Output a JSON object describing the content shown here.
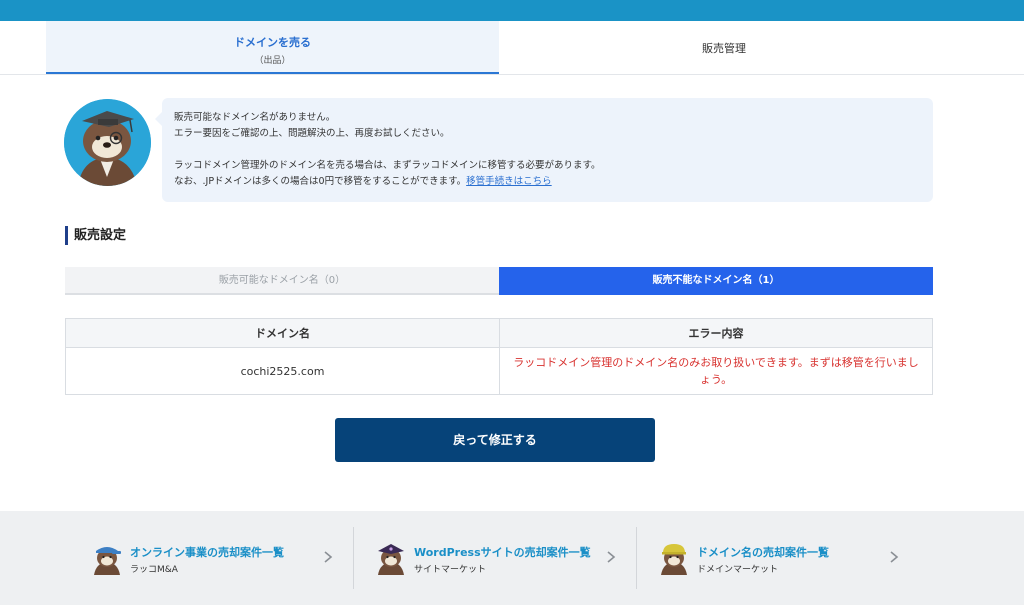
{
  "top_tabs": {
    "sell_label": "ドメインを売る",
    "sell_sub": "（出品）",
    "manage_label": "販売管理"
  },
  "notice": {
    "line1": "販売可能なドメイン名がありません。",
    "line2": "エラー要因をご確認の上、問題解決の上、再度お試しください。",
    "line3": "ラッコドメイン管理外のドメイン名を売る場合は、まずラッコドメインに移管する必要があります。",
    "line4": "なお、.JPドメインは多くの場合は0円で移管をすることができます。",
    "link": "移管手続きはこちら"
  },
  "section_title": "販売設定",
  "sub_tabs": {
    "available": "販売可能なドメイン名（0）",
    "unavailable": "販売不能なドメイン名（1）"
  },
  "table": {
    "headers": [
      "ドメイン名",
      "エラー内容"
    ],
    "rows": [
      {
        "domain": "cochi2525.com",
        "error": "ラッコドメイン管理のドメイン名のみお取り扱いできます。まずは移管を行いましょう。"
      }
    ]
  },
  "back_button": "戻って修正する",
  "footer": {
    "cards": [
      {
        "title": "オンライン事業の売却案件一覧",
        "subtitle": "ラッコM&A",
        "icon": "otter-blue-cap-icon"
      },
      {
        "title": "WordPressサイトの売却案件一覧",
        "subtitle": "サイトマーケット",
        "icon": "otter-purple-hat-icon"
      },
      {
        "title": "ドメイン名の売却案件一覧",
        "subtitle": "ドメインマーケット",
        "icon": "otter-yellow-helmet-icon"
      }
    ]
  },
  "colors": {
    "topbar": "#1a93c6",
    "accent_blue": "#2563eb",
    "button_navy": "#064379",
    "error_red": "#d8322f",
    "link_blue": "#2a6fd0"
  }
}
